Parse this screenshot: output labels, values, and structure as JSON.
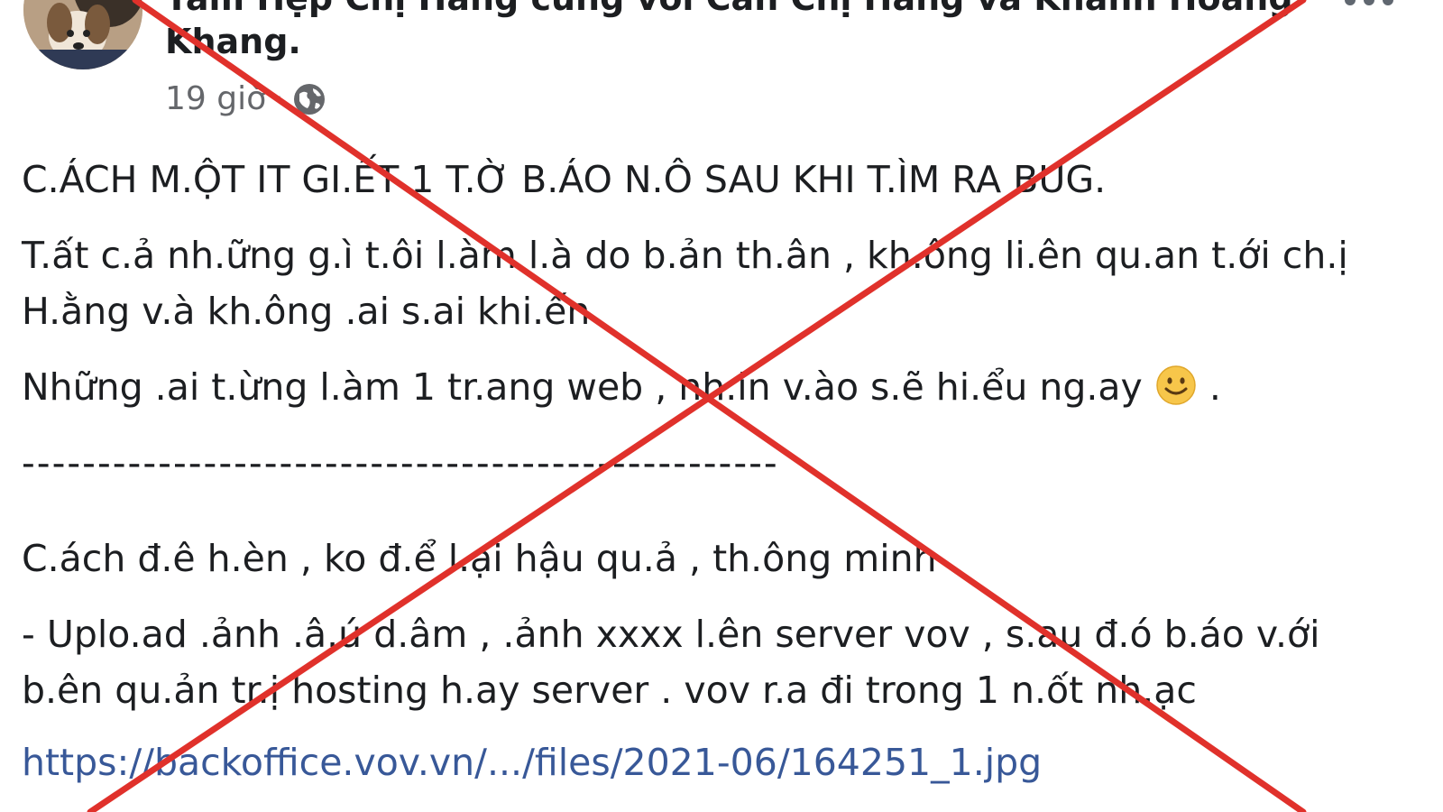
{
  "post": {
    "header_partial": "Tâm Hẹp Chị Hằng cùng với Cẩn Chị Hằng và Khánh Hoàng",
    "author_tail": "Khang.",
    "time": "19 giờ",
    "separator": "·",
    "audience_icon": "globe-icon",
    "menu_icon": "more-options-icon",
    "paragraphs": {
      "title": "C.ÁCH M.ỘT IT GI.ẾT 1 T.Ờ B.ÁO N.Ô SAU KHI T.ÌM RA BUG.",
      "p1": "T.ất c.ả nh.ững g.ì t.ôi l.àm l.à do b.ản th.ân , kh.ông li.ên qu.an t.ới ch.ị H.ằng v.à kh.ông .ai s.ai khi.ến",
      "p2_text": "Những .ai t.ừng l.àm 1 tr.ang web , nh.in v.ào s.ẽ hi.ểu ng.ay",
      "p2_end": " .",
      "divider": "--------------------------------------------------",
      "p3": "C.ách đ.ê h.èn , ko đ.ể l.ại hậu qu.ả , th.ông minh",
      "p4": "- Uplo.ad .ảnh .â.ú d.âm  , .ảnh xxxx l.ên server vov , s.au đ.ó b.áo v.ới b.ên qu.ản tr.ị hosting h.ay server . vov r.a đi trong 1   n.ốt nh.ạc",
      "link": "https://backoffice.vov.vn/.../files/2021-06/164251_1.jpg"
    },
    "emoji_icon": "smile-icon"
  },
  "overlay": {
    "type": "red-x-cross",
    "color": "#e0312b"
  }
}
